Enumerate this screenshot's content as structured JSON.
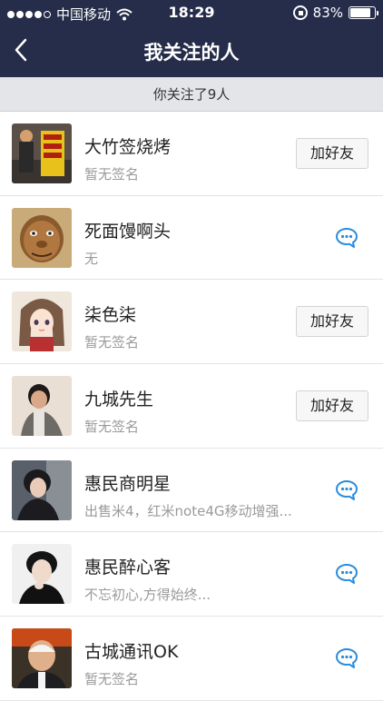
{
  "status_bar": {
    "carrier": "中国移动",
    "time": "18:29",
    "battery": "83%",
    "battery_level": 0.83
  },
  "nav": {
    "title": "我关注的人"
  },
  "count_text": "你关注了9人",
  "add_label": "加好友",
  "people": [
    {
      "name": "大竹签烧烤",
      "signature": "暂无签名",
      "action": "add",
      "avatar": "sign-photo-avatar"
    },
    {
      "name": "死面馒啊头",
      "signature": "无",
      "action": "chat",
      "avatar": "cartoon-face-avatar"
    },
    {
      "name": "柒色柒",
      "signature": "暂无签名",
      "action": "add",
      "avatar": "anime-girl-avatar"
    },
    {
      "name": "九城先生",
      "signature": "暂无签名",
      "action": "add",
      "avatar": "man-photo-avatar"
    },
    {
      "name": "惠民商明星",
      "signature": "出售米4，红米note4G移动增强...",
      "action": "chat",
      "avatar": "young-man-avatar"
    },
    {
      "name": "惠民醉心客",
      "signature": "不忘初心,方得始终...",
      "action": "chat",
      "avatar": "young-man-avatar-2"
    },
    {
      "name": "古城通讯OK",
      "signature": "暂无签名",
      "action": "chat",
      "avatar": "man-suit-avatar"
    }
  ],
  "colors": {
    "header": "#252d4a",
    "chat_icon": "#2a8cdc",
    "count_bar": "#e4e5e8"
  }
}
